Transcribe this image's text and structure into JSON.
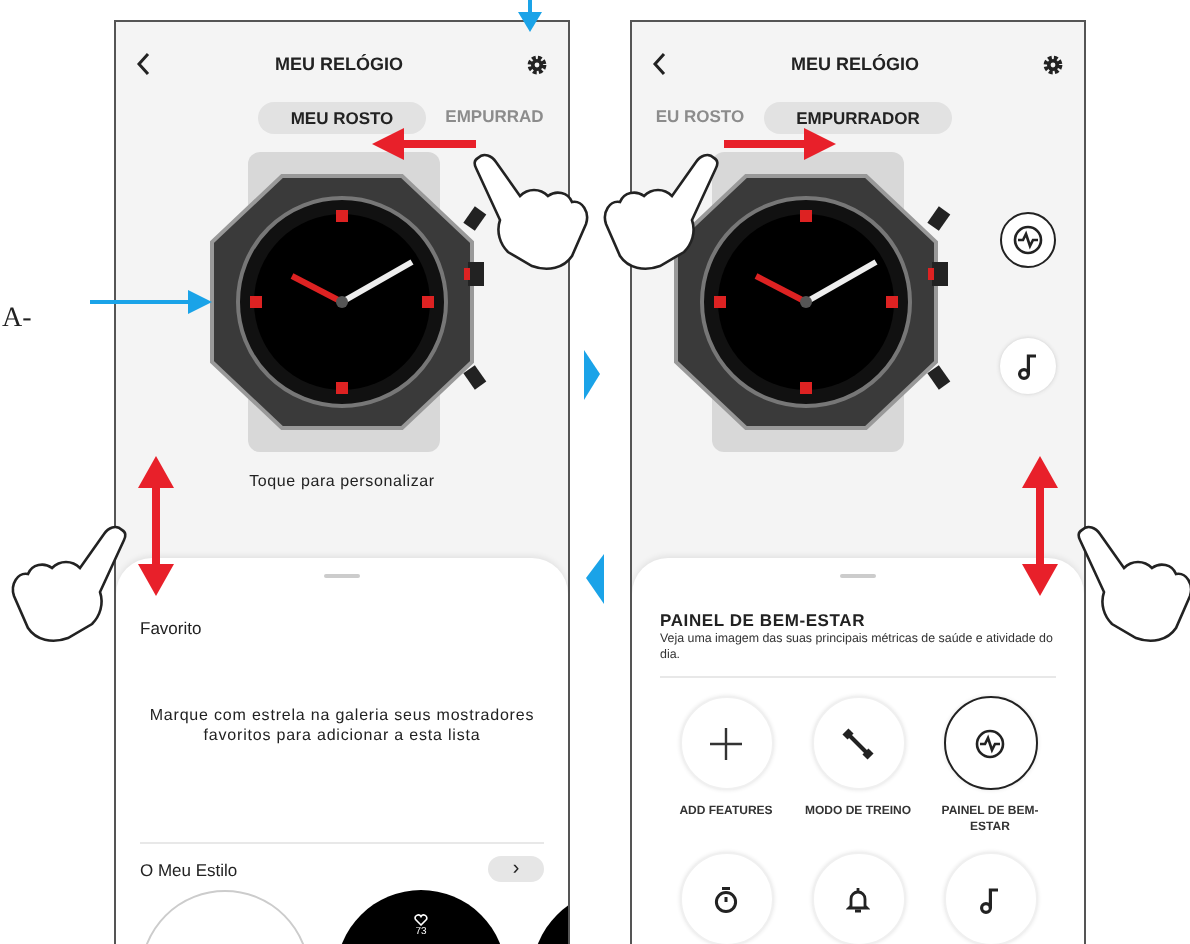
{
  "caption_fragment": "A-",
  "screens": [
    {
      "kind": "faces",
      "title": "MEU RELÓGIO",
      "tabs": [
        {
          "label": "MEU ROSTO",
          "selected": true
        },
        {
          "label": "EMPURRAD",
          "selected": false
        }
      ],
      "hint": "Toque para personalizar",
      "sheet": {
        "heading": "Favorito",
        "message": "Marque com estrela na galeria seus mostradores favoritos para adicionar a esta lista",
        "section_title": "O Meu Estilo",
        "more_button": "›",
        "faces": [
          {
            "kind": "add"
          },
          {
            "kind": "dark",
            "reading": "73"
          },
          {
            "kind": "dark"
          }
        ]
      }
    },
    {
      "kind": "pusher",
      "title": "MEU RELÓGIO",
      "tabs": [
        {
          "label": "EU ROSTO",
          "selected": false
        },
        {
          "label": "EMPURRADOR",
          "selected": true
        }
      ],
      "side_buttons": [
        {
          "kind": "wellness"
        },
        {
          "kind": "music"
        }
      ],
      "sheet": {
        "heading": "PAINEL DE BEM-ESTAR",
        "description": "Veja uma imagem das suas principais métricas de saúde e atividade do dia.",
        "features": [
          {
            "kind": "add",
            "label": "ADD FEATURES",
            "selected": false
          },
          {
            "kind": "training",
            "label": "MODO DE TREINO",
            "selected": false
          },
          {
            "kind": "wellness",
            "label": "PAINEL DE BEM-ESTAR",
            "selected": true
          },
          {
            "kind": "stopwatch",
            "selected": false
          },
          {
            "kind": "bell",
            "selected": false
          },
          {
            "kind": "music",
            "selected": false
          }
        ]
      }
    }
  ]
}
